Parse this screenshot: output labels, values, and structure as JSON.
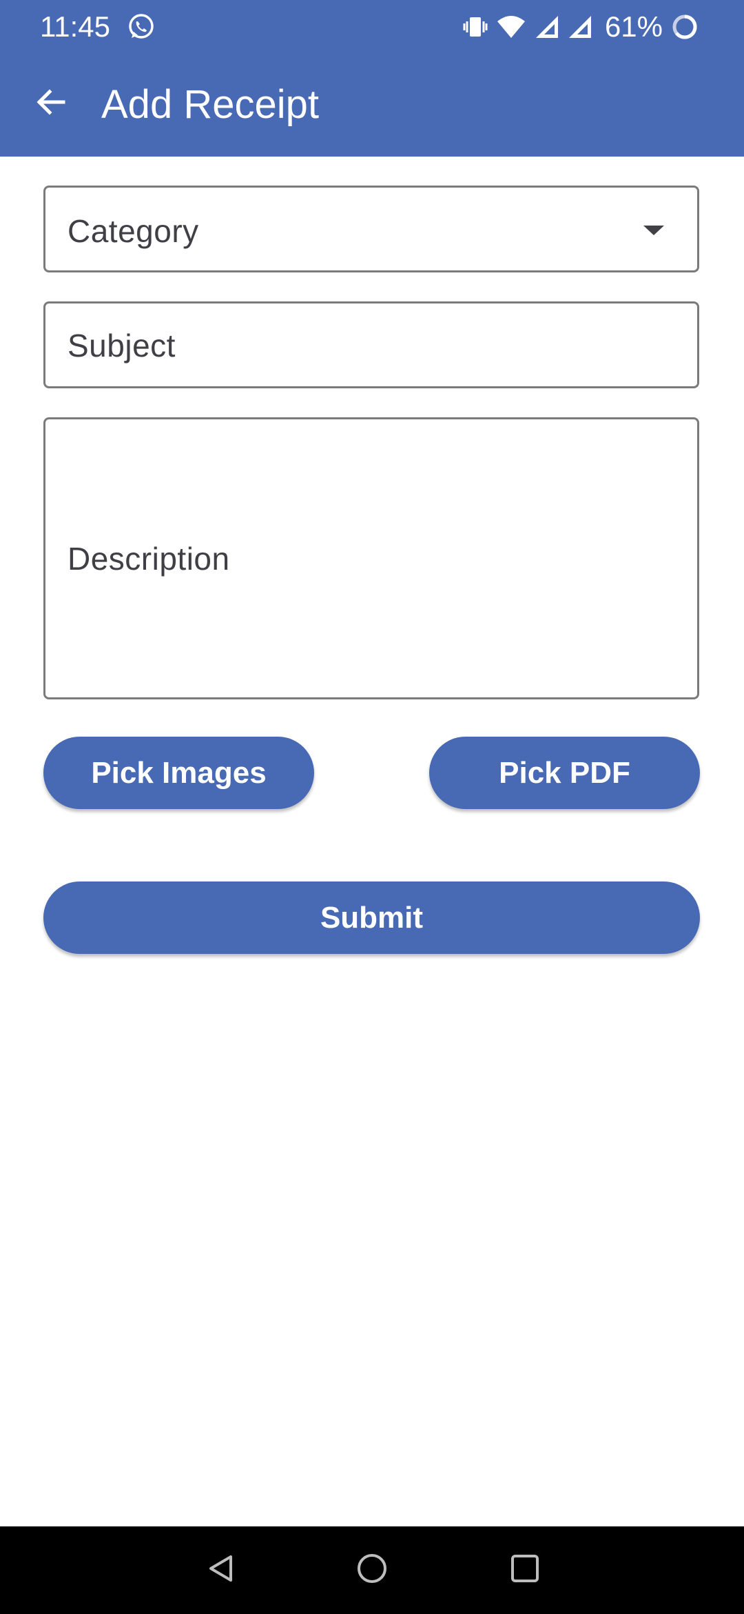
{
  "status_bar": {
    "time": "11:45",
    "battery": "61%",
    "icons": [
      "whatsapp-icon",
      "vibrate-icon",
      "wifi-icon",
      "signal-icon",
      "signal-icon",
      "battery-icon"
    ]
  },
  "app_bar": {
    "title": "Add Receipt",
    "back_icon": "arrow-left-icon"
  },
  "form": {
    "category": {
      "label": "Category",
      "icon": "dropdown-arrow-icon"
    },
    "subject": {
      "label": "Subject"
    },
    "description": {
      "label": "Description"
    },
    "pick_images_label": "Pick Images",
    "pick_pdf_label": "Pick PDF",
    "submit_label": "Submit"
  },
  "nav_bar": {
    "icons": [
      "back-triangle-icon",
      "home-circle-icon",
      "recents-square-icon"
    ]
  },
  "colors": {
    "primary": "#4869b3",
    "field_border": "#7b7b7b",
    "label_text": "#3f3f45",
    "nav_bar": "#000000"
  }
}
